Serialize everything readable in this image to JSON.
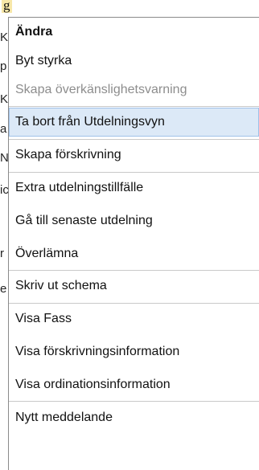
{
  "background": {
    "topline": "g",
    "left_frags": [
      "K",
      "p",
      "Kr",
      "a",
      "N",
      "ic",
      "r",
      "e"
    ]
  },
  "menu": {
    "items": [
      {
        "label": "Ändra",
        "bold": true
      },
      {
        "label": "Byt styrka"
      },
      {
        "label": "Skapa överkänslighetsvarning",
        "disabled": true
      },
      {
        "label": "Ta bort från Utdelningsvyn",
        "highlighted": true
      },
      {
        "label": "Skapa förskrivning"
      },
      {
        "label": "Extra utdelningstillfälle"
      },
      {
        "label": "Gå till senaste utdelning"
      },
      {
        "label": "Överlämna"
      },
      {
        "label": "Skriv ut schema"
      },
      {
        "label": "Visa Fass"
      },
      {
        "label": "Visa förskrivningsinformation"
      },
      {
        "label": "Visa ordinationsinformation"
      },
      {
        "label": "Nytt meddelande"
      }
    ]
  },
  "colors": {
    "highlight_bg": "#dce9f7",
    "highlight_border": "#9fc1e8",
    "disabled_text": "#8d8d8d",
    "separator": "#c9c9c9"
  }
}
